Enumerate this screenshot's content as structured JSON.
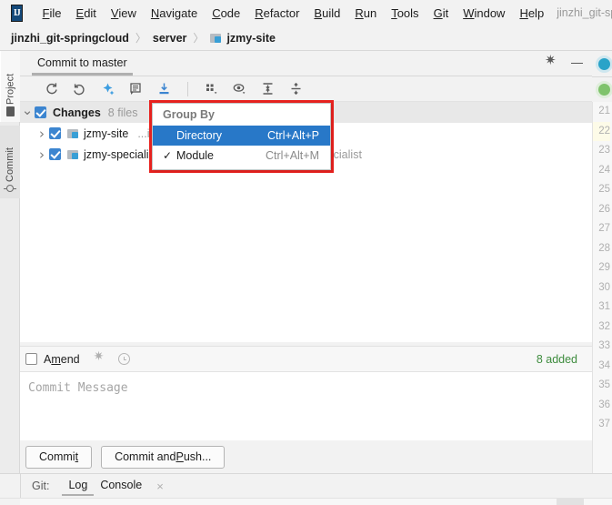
{
  "menubar": {
    "logo": "IJ",
    "items": [
      {
        "label": "File",
        "mnemonic": "F"
      },
      {
        "label": "Edit",
        "mnemonic": "E"
      },
      {
        "label": "View",
        "mnemonic": "V"
      },
      {
        "label": "Navigate",
        "mnemonic": "N"
      },
      {
        "label": "Code",
        "mnemonic": "C"
      },
      {
        "label": "Refactor",
        "mnemonic": "R"
      },
      {
        "label": "Build",
        "mnemonic": "B"
      },
      {
        "label": "Run",
        "mnemonic": "R"
      },
      {
        "label": "Tools",
        "mnemonic": "T"
      },
      {
        "label": "Git",
        "mnemonic": "G"
      },
      {
        "label": "Window",
        "mnemonic": "W"
      },
      {
        "label": "Help",
        "mnemonic": "H"
      }
    ],
    "project_title": "jinzhi_git-spring"
  },
  "breadcrumb": {
    "project": "jinzhi_git-springcloud",
    "folder": "server",
    "module": "jzmy-site",
    "separator": "〉"
  },
  "left_tool_strip": {
    "tabs": [
      {
        "label": "Project",
        "icon": "folder-icon",
        "active": false
      },
      {
        "label": "Commit",
        "icon": "commit-icon",
        "active": true
      }
    ]
  },
  "tool_window": {
    "tab_label": "Commit to master",
    "settings_icon": "gear-icon",
    "minimize_icon": "minimize-icon"
  },
  "changes_toolbar": {
    "buttons": [
      {
        "name": "refresh-icon",
        "title": "Refresh"
      },
      {
        "name": "rollback-icon",
        "title": "Rollback"
      },
      {
        "name": "shelve-icon",
        "title": "Shelve Silently"
      },
      {
        "name": "diff-icon",
        "title": "Show Diff"
      },
      {
        "name": "commit-file-icon",
        "title": "Commit File"
      },
      {
        "name": "group-by-icon",
        "title": "Group By"
      },
      {
        "name": "preview-icon",
        "title": "Preview Diff"
      },
      {
        "name": "expand-all-icon",
        "title": "Expand All"
      },
      {
        "name": "collapse-all-icon",
        "title": "Collapse All"
      }
    ]
  },
  "changes_tree": {
    "root": {
      "label": "Changes",
      "count_text": "8 files",
      "checked": true,
      "expanded": true
    },
    "nodes": [
      {
        "label": "jzmy-site",
        "path": "...ingcloud\\server\\jzmy-site",
        "checked": true,
        "expanded": false
      },
      {
        "label": "jzmy-specialist",
        "path": "...git-springcloud\\server\\jzmy-specialist",
        "checked": true,
        "expanded": false
      }
    ]
  },
  "popup": {
    "title": "Group By",
    "highlight_color": "#e8221f",
    "selection_color": "#2878c8",
    "items": [
      {
        "label": "Directory",
        "shortcut": "Ctrl+Alt+P",
        "checked": false,
        "selected": true
      },
      {
        "label": "Module",
        "shortcut": "Ctrl+Alt+M",
        "checked": true,
        "selected": false
      }
    ],
    "check_glyph": "✓"
  },
  "amend_bar": {
    "label": "Amend",
    "mnemonic": "m",
    "checked": false,
    "gear_icon": "gear-icon",
    "history_icon": "clock-icon",
    "added_text": "8 added",
    "added_color": "#3e8c3e"
  },
  "commit_message": {
    "placeholder": "Commit Message",
    "value": ""
  },
  "commit_buttons": {
    "commit": {
      "label": "Commit",
      "mnemonic": "t"
    },
    "commit_and_push": {
      "label": "Commit and Push...",
      "mnemonic": "P"
    }
  },
  "gutter": {
    "line_numbers": [
      "21",
      "22",
      "23",
      "24",
      "25",
      "26",
      "27",
      "28",
      "29",
      "30",
      "31",
      "32",
      "33",
      "34",
      "35",
      "36",
      "37"
    ],
    "highlighted_line": "22"
  },
  "status_bar": {
    "vcs_label": "Git:",
    "tabs": [
      {
        "label": "Log",
        "active": true,
        "closable": false
      },
      {
        "label": "Console",
        "active": false,
        "closable": true
      }
    ],
    "close_glyph": "×"
  }
}
